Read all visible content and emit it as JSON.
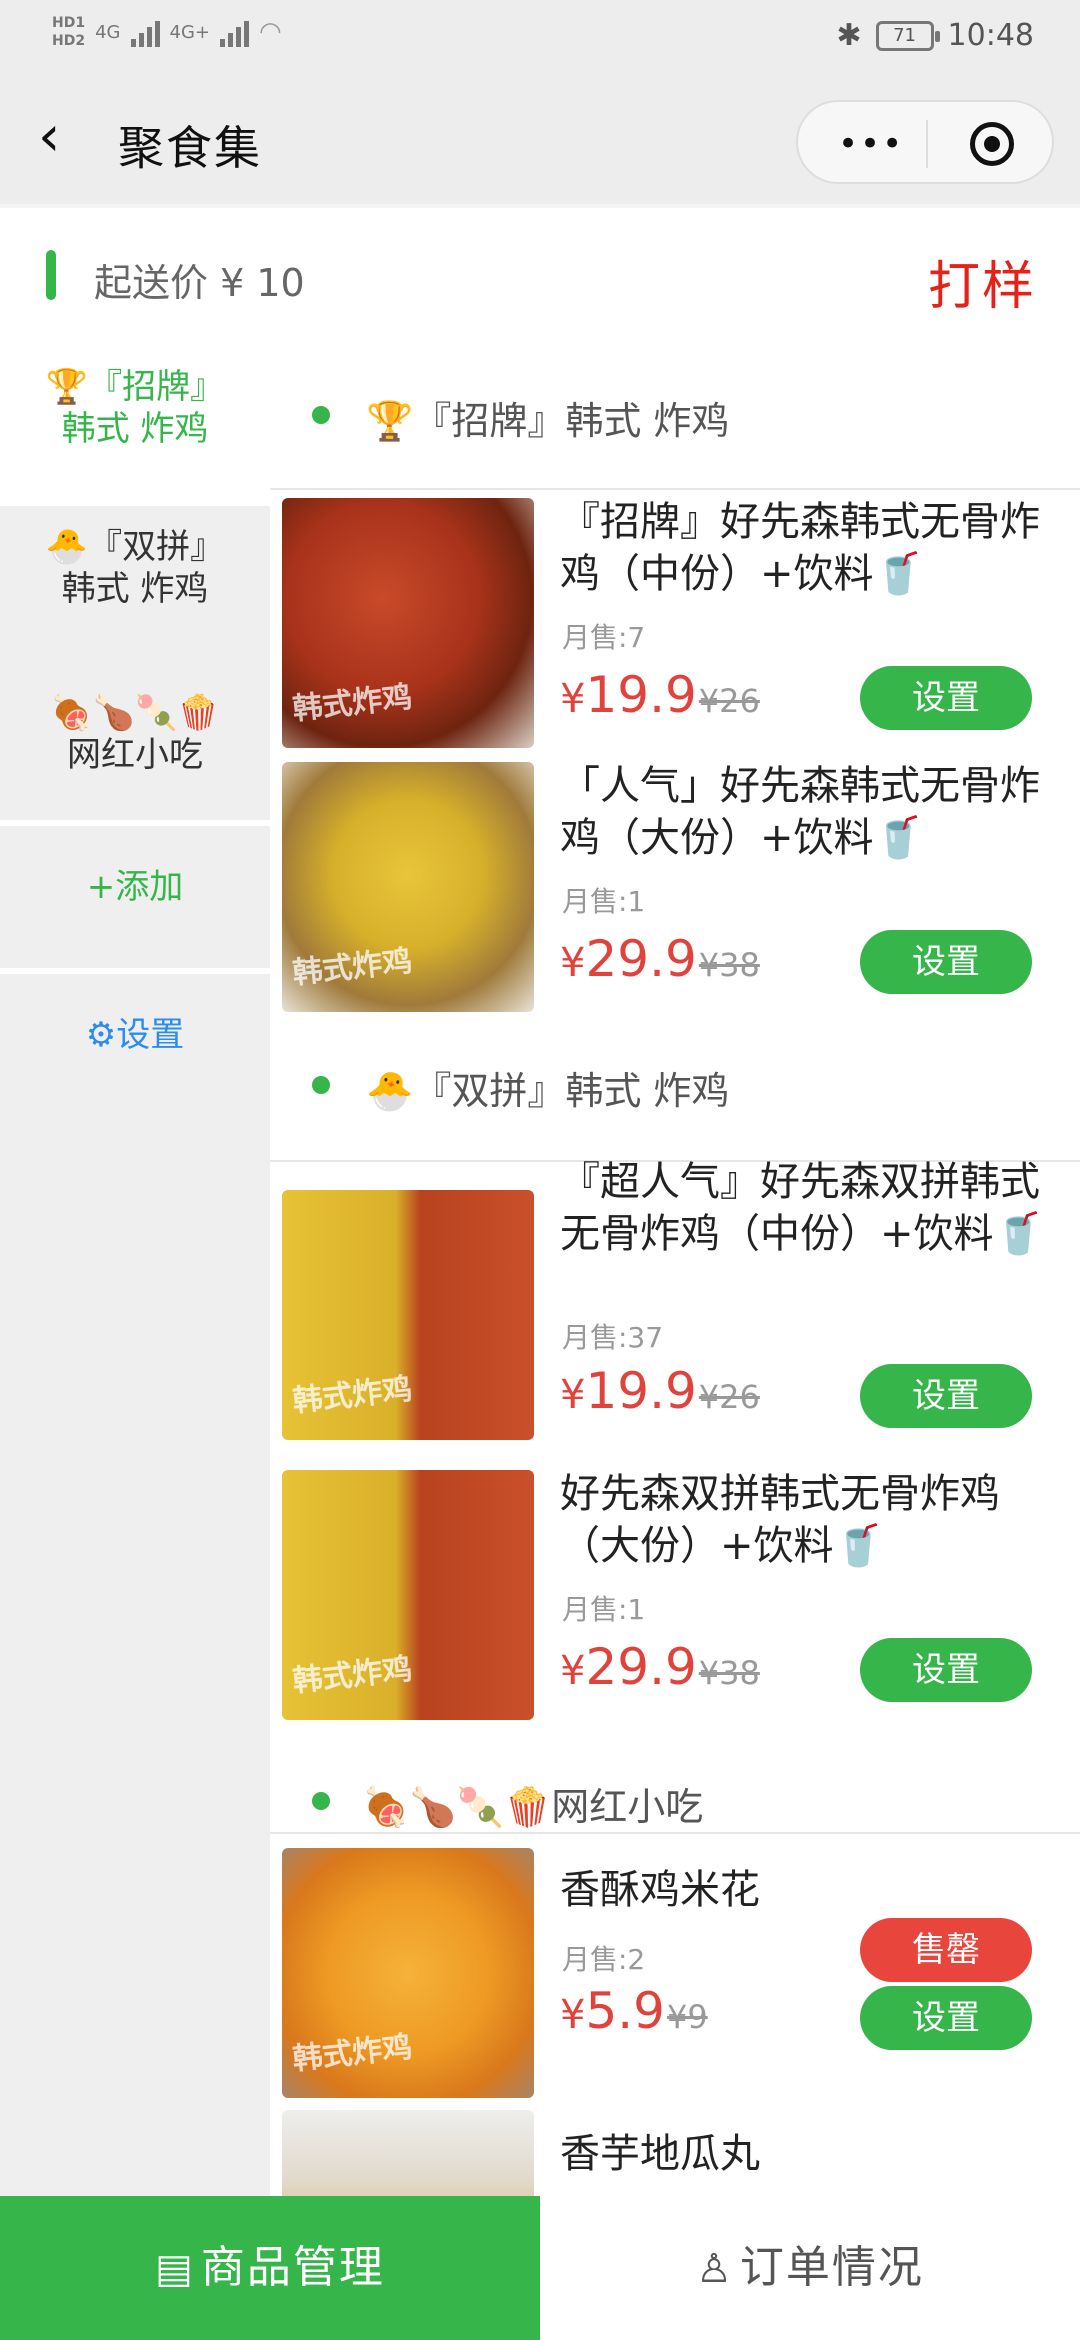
{
  "status_bar": {
    "net1": "4G",
    "net2": "4G+",
    "battery": "71",
    "time": "10:48"
  },
  "nav": {
    "title": "聚食集",
    "back_icon": "chevron-left-icon",
    "more_icon": "more-dots-icon",
    "close_icon": "target-icon"
  },
  "header": {
    "min_price": "起送价 ¥ 10",
    "status": "打样"
  },
  "sidebar": {
    "items": [
      {
        "emoji": "🏆",
        "label": "『招牌』韩式 炸鸡",
        "line1": "『招牌』",
        "line2": "韩式 炸鸡",
        "active": true
      },
      {
        "emoji": "🐣",
        "label": "『双拼』韩式 炸鸡",
        "line1": "『双拼』",
        "line2": "韩式 炸鸡",
        "active": false
      },
      {
        "emoji": "🍖🍗🍡🍿",
        "label": "网红小吃",
        "line1": "",
        "line2": "网红小吃",
        "active": false
      }
    ],
    "add_label": "+添加",
    "settings_label": "设置"
  },
  "categories": [
    {
      "title": "🏆『招牌』韩式 炸鸡",
      "items": [
        {
          "name": "『招牌』好先森韩式无骨炸鸡（中份）+饮料🥤",
          "sold": "月售:7",
          "price": "19.9",
          "orig": "¥26",
          "buttons": [
            "设置"
          ]
        },
        {
          "name": "「人气」好先森韩式无骨炸鸡（大份）+饮料🥤",
          "sold": "月售:1",
          "price": "29.9",
          "orig": "¥38",
          "buttons": [
            "设置"
          ]
        }
      ]
    },
    {
      "title": "🐣『双拼』韩式 炸鸡",
      "items": [
        {
          "name": "『超人气』好先森双拼韩式无骨炸鸡（中份）+饮料🥤",
          "sold": "月售:37",
          "price": "19.9",
          "orig": "¥26",
          "buttons": [
            "设置"
          ]
        },
        {
          "name": "好先森双拼韩式无骨炸鸡（大份）+饮料🥤",
          "sold": "月售:1",
          "price": "29.9",
          "orig": "¥38",
          "buttons": [
            "设置"
          ]
        }
      ]
    },
    {
      "title": "🍖🍗🍡🍿网红小吃",
      "items": [
        {
          "name": "香酥鸡米花",
          "sold": "月售:2",
          "price": "5.9",
          "orig": "¥9",
          "buttons": [
            "售罄",
            "设置"
          ]
        },
        {
          "name": "香芋地瓜丸",
          "sold": "",
          "price": "",
          "orig": "",
          "buttons": []
        }
      ]
    }
  ],
  "currency": "¥",
  "tabbar": {
    "tabs": [
      {
        "label": "商品管理",
        "icon": "store-icon",
        "active": true
      },
      {
        "label": "订单情况",
        "icon": "user-icon",
        "active": false
      }
    ]
  },
  "colors": {
    "accent": "#35b54a",
    "price": "#e0433b",
    "danger": "#e8463d",
    "status": "#e62117",
    "link": "#2d8cf0"
  }
}
